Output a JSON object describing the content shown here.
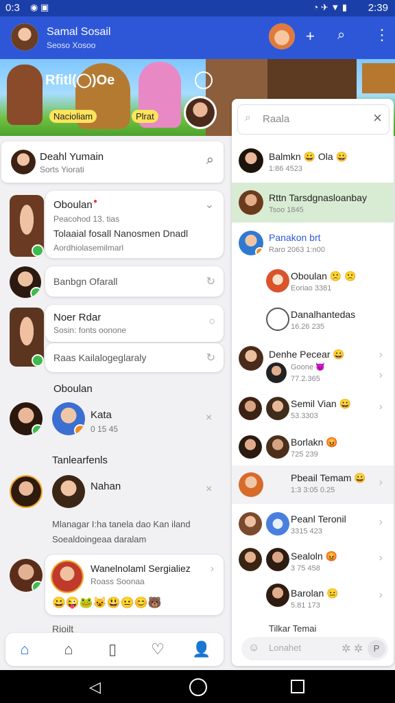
{
  "status_bar": {
    "time_left": "0:3",
    "time_right": "2:39"
  },
  "app_bar": {
    "title": "Samal Sosail",
    "subtitle": "Seoso Xosoo"
  },
  "banner": {
    "caption_top": "Rfitl(◯)Oe",
    "caption_left": "Nacioliam",
    "caption_right": "Plrat"
  },
  "profile_card": {
    "name": "Deahl Yumain",
    "sub": "Sorts Yiorati"
  },
  "left_items": [
    {
      "title": "Oboulan",
      "line1": "Peacohod 13. tias",
      "line2": "Tolaaial fosall Nanosmen Dnadl",
      "line3": "Aordhiolasemilmarl"
    },
    {
      "title": "Banbgn Ofarall"
    },
    {
      "title": "Noer Rdar",
      "line1": "Sosin: fonts oonone"
    },
    {
      "title": "Raas Kailalogeglaraly"
    }
  ],
  "section1": {
    "title": "Oboulan",
    "item_name": "Kata",
    "item_sub": "0 15 45"
  },
  "section2": {
    "title": "Tanlearfenls",
    "item_name": "Nahan",
    "note1": "Mlanagar I:ha tanela dao Kan iland",
    "note2": "Soealdoingeaa daralam"
  },
  "section3": {
    "name": "Wanelnolaml Sergialiez",
    "sub": "Roass Soonaa",
    "cutoff": "Rioilt"
  },
  "right_panel": {
    "search_text": "Raala",
    "input_placeholder": "Lonahet",
    "footer_name": "Tilkar Temai",
    "items": [
      {
        "name": "Balmkn 😀 Ola 😀",
        "sub": "1:86 4523"
      },
      {
        "name": "Rttn Tarsdgnasloanbay",
        "sub": "Tsoo 1845"
      },
      {
        "name": "Panakon brt",
        "sub": "Raro 2063 1:n00"
      },
      {
        "name": "Oboulan 🙁 🙁",
        "sub": "Eoriao 3381"
      },
      {
        "name": "Danalhantedas",
        "sub": "16.26 235"
      },
      {
        "name": "Denhe Pecear 😀",
        "sub": "Goone 😈"
      },
      {
        "name": "Semil Vian 😀",
        "sub": "53.3303"
      },
      {
        "name": "Borlakn 😡",
        "sub": "725 239"
      },
      {
        "name": "Pbeail Temam 😀",
        "sub": "1:3 3:05 0.25"
      },
      {
        "name": "Peanl Teronil",
        "sub": "3315 423"
      },
      {
        "name": "Sealoln 😡",
        "sub": "3 75 458"
      },
      {
        "name": "Barolan 😐",
        "sub": "5.81 173"
      }
    ]
  },
  "extra_subs": {
    "denhe_second": "77.2.365"
  }
}
